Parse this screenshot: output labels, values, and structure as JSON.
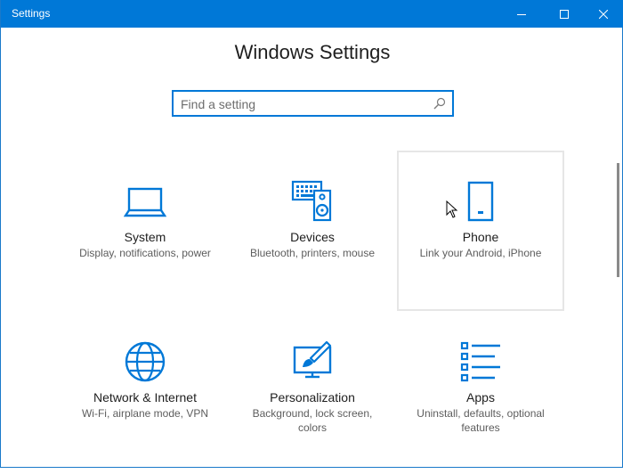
{
  "window": {
    "title": "Settings"
  },
  "page": {
    "title": "Windows Settings"
  },
  "search": {
    "placeholder": "Find a setting",
    "value": ""
  },
  "tiles": [
    {
      "title": "System",
      "desc": "Display, notifications, power",
      "icon": "laptop-icon"
    },
    {
      "title": "Devices",
      "desc": "Bluetooth, printers, mouse",
      "icon": "keyboard-speaker-icon"
    },
    {
      "title": "Phone",
      "desc": "Link your Android, iPhone",
      "icon": "phone-icon"
    },
    {
      "title": "Network & Internet",
      "desc": "Wi-Fi, airplane mode, VPN",
      "icon": "globe-icon"
    },
    {
      "title": "Personalization",
      "desc": "Background, lock screen, colors",
      "icon": "paint-monitor-icon"
    },
    {
      "title": "Apps",
      "desc": "Uninstall, defaults, optional features",
      "icon": "list-icon"
    }
  ],
  "colors": {
    "accent": "#0078d7",
    "title_bar": "#0078d7",
    "hover_border": "#e6e6e6",
    "text": "#1e1e1e",
    "secondary_text": "#5d5d5d"
  }
}
